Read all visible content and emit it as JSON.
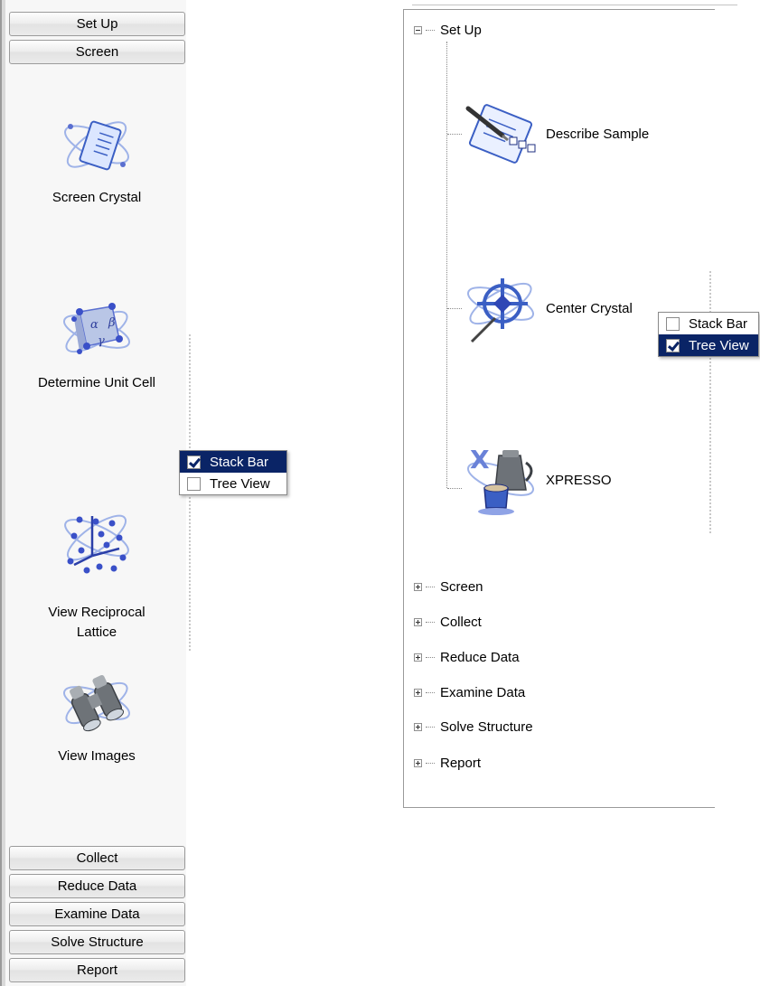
{
  "stack_bar": {
    "top_buttons": [
      "Set Up",
      "Screen"
    ],
    "tools": [
      {
        "label": "Screen Crystal",
        "icon": "screen-crystal-icon"
      },
      {
        "label": "Determine Unit Cell",
        "icon": "unit-cell-icon"
      },
      {
        "label": "View Reciprocal\nLattice",
        "icon": "reciprocal-lattice-icon"
      },
      {
        "label": "View Images",
        "icon": "binoculars-icon"
      }
    ],
    "bottom_buttons": [
      "Collect",
      "Reduce Data",
      "Examine Data",
      "Solve Structure",
      "Report"
    ]
  },
  "left_menu": {
    "items": [
      {
        "label": "Stack Bar",
        "checked": true,
        "selected": true
      },
      {
        "label": "Tree View",
        "checked": false,
        "selected": false
      }
    ]
  },
  "tree": {
    "root": {
      "label": "Set Up",
      "expanded": true
    },
    "children": [
      {
        "label": "Describe Sample",
        "icon": "describe-sample-icon"
      },
      {
        "label": "Center Crystal",
        "icon": "center-crystal-icon"
      },
      {
        "label": "XPRESSO",
        "icon": "xpresso-icon"
      }
    ],
    "collapsed": [
      "Screen",
      "Collect",
      "Reduce Data",
      "Examine Data",
      "Solve Structure",
      "Report"
    ]
  },
  "right_menu": {
    "items": [
      {
        "label": "Stack Bar",
        "checked": false,
        "selected": false
      },
      {
        "label": "Tree View",
        "checked": true,
        "selected": true
      }
    ]
  }
}
